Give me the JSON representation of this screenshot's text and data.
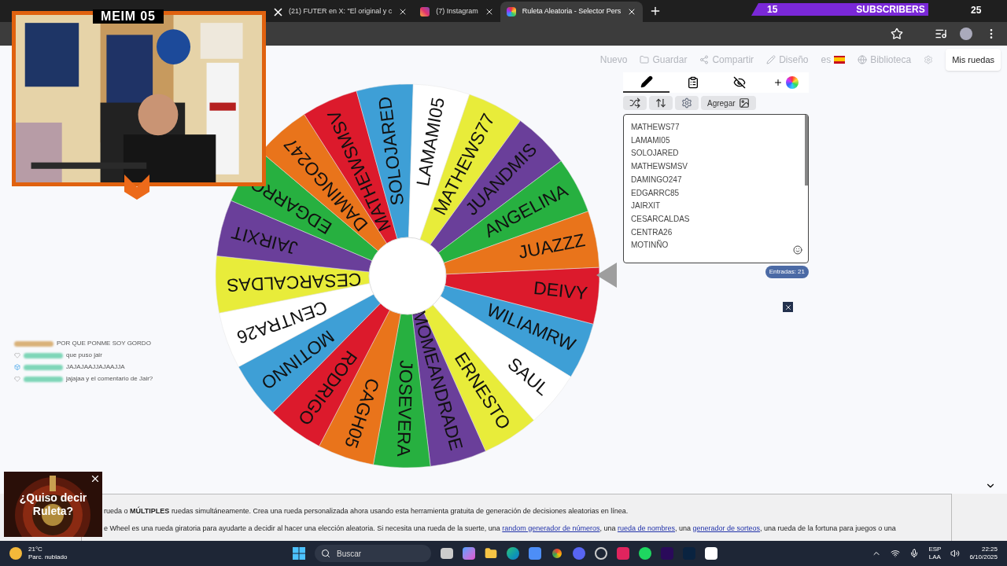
{
  "browser": {
    "tabs": [
      {
        "title": "(21) FUTER en X: \"El original y c",
        "kind": "x",
        "selected": false
      },
      {
        "title": "(7) Instagram",
        "kind": "instagram",
        "selected": false
      },
      {
        "title": "Ruleta Aleatoria - Selector Pers",
        "kind": "wheel",
        "selected": true
      }
    ]
  },
  "overlay": {
    "channel": "MEIM 05",
    "subscribers": {
      "count": "15",
      "label": "SUBSCRIBERS",
      "goal": "25"
    },
    "chat": [
      {
        "kind": "plain",
        "message": "POR QUE PONME SOY GORDO",
        "color": "#d9b27a"
      },
      {
        "kind": "shield",
        "message": "que puso jair",
        "color": "#7fd6b8"
      },
      {
        "kind": "cube",
        "message": "JAJAJAAJJAJAAJJA",
        "color": "#7fd6b8"
      },
      {
        "kind": "shield",
        "message": "jajajaa y el comentario de Jair?",
        "color": "#7fd6b8"
      }
    ],
    "popup": {
      "text": "¿Quiso decir Ruleta?"
    }
  },
  "page": {
    "nav": [
      {
        "label": "Nuevo",
        "kind": "plain"
      },
      {
        "label": "Guardar",
        "kind": "folder"
      },
      {
        "label": "Compartir",
        "kind": "share"
      },
      {
        "label": "Diseño",
        "kind": "pencil"
      },
      {
        "label": "es",
        "kind": "flag"
      },
      {
        "label": "Biblioteca",
        "kind": "globe"
      }
    ],
    "my_wheels": "Mis ruedas",
    "editor_tabs": [
      {
        "kind": "pencil",
        "selected": true
      },
      {
        "kind": "clipboard",
        "selected": false
      },
      {
        "kind": "eye-off",
        "selected": false
      },
      {
        "kind": "add-color",
        "selected": false
      }
    ],
    "tools": [
      {
        "kind": "shuffle"
      },
      {
        "kind": "sort"
      },
      {
        "kind": "settings"
      },
      {
        "kind": "add-image",
        "label": "Agregar"
      }
    ],
    "entries": [
      "MATHEWS77",
      "LAMAMI05",
      "SOLOJARED",
      "MATHEWSMSV",
      "DAMINGO247",
      "EDGARRC85",
      "JAIRXIT",
      "CESARCALDAS",
      "CENTRA26",
      "MOTINÑO"
    ],
    "entry_count": "Entradas: 21",
    "wheel": {
      "segments": [
        {
          "label": "DEIVY",
          "color": "#dc1a2c"
        },
        {
          "label": "WILIAMRW",
          "color": "#3e9fd6"
        },
        {
          "label": "SAUL",
          "color": "#ffffff"
        },
        {
          "label": "ERNESTO",
          "color": "#e8ec3a"
        },
        {
          "label": "MOMEANDRADE",
          "color": "#6a3f9a"
        },
        {
          "label": "JOSEVERA",
          "color": "#27b040"
        },
        {
          "label": "CAGH05",
          "color": "#e9741b"
        },
        {
          "label": "RODRIGO",
          "color": "#dc1a2c"
        },
        {
          "label": "MOTINNO",
          "color": "#3e9fd6"
        },
        {
          "label": "CENTRA26",
          "color": "#ffffff"
        },
        {
          "label": "CESARCALDAS",
          "color": "#e8ec3a"
        },
        {
          "label": "JAIRXIT",
          "color": "#6a3f9a"
        },
        {
          "label": "EDGARRC",
          "color": "#27b040"
        },
        {
          "label": "DAMINGO247",
          "color": "#e9741b"
        },
        {
          "label": "MATHEWSMSV",
          "color": "#dc1a2c"
        },
        {
          "label": "SOLOJARED",
          "color": "#3e9fd6"
        },
        {
          "label": "LAMAMI05",
          "color": "#ffffff"
        },
        {
          "label": "MATHEWS77",
          "color": "#e8ec3a"
        },
        {
          "label": "JUANDMIS",
          "color": "#6a3f9a"
        },
        {
          "label": "ANGELINA",
          "color": "#27b040"
        },
        {
          "label": "JUAZZZ",
          "color": "#e9741b"
        }
      ]
    },
    "article": [
      [
        {
          "text": "rueda o **MÚLTIPLES** ruedas simultáneamente. Crea una rueda personalizada ahora usando esta herramienta gratuita de generación de decisiones aleatorias en línea.",
          "link": false
        }
      ],
      [
        {
          "text": "e Wheel es una rueda giratoria para ayudarte a decidir al hacer una elección aleatoria. Si necesita una rueda de la suerte, una ",
          "link": false
        },
        {
          "text": "random generador de números",
          "link": true
        },
        {
          "text": ", una ",
          "link": false
        },
        {
          "text": "rueda de nombres",
          "link": true
        },
        {
          "text": ", una ",
          "link": false
        },
        {
          "text": "generador de sorteos",
          "link": true
        },
        {
          "text": ", una rueda de la fortuna para juegos o una",
          "link": false
        }
      ]
    ]
  },
  "taskbar": {
    "temperature": "21°C",
    "weather": "Parc. nublado",
    "search_placeholder": "Buscar",
    "language": "ESP",
    "layout": "LAA",
    "time": "22:25",
    "date": "6/10/2025"
  }
}
